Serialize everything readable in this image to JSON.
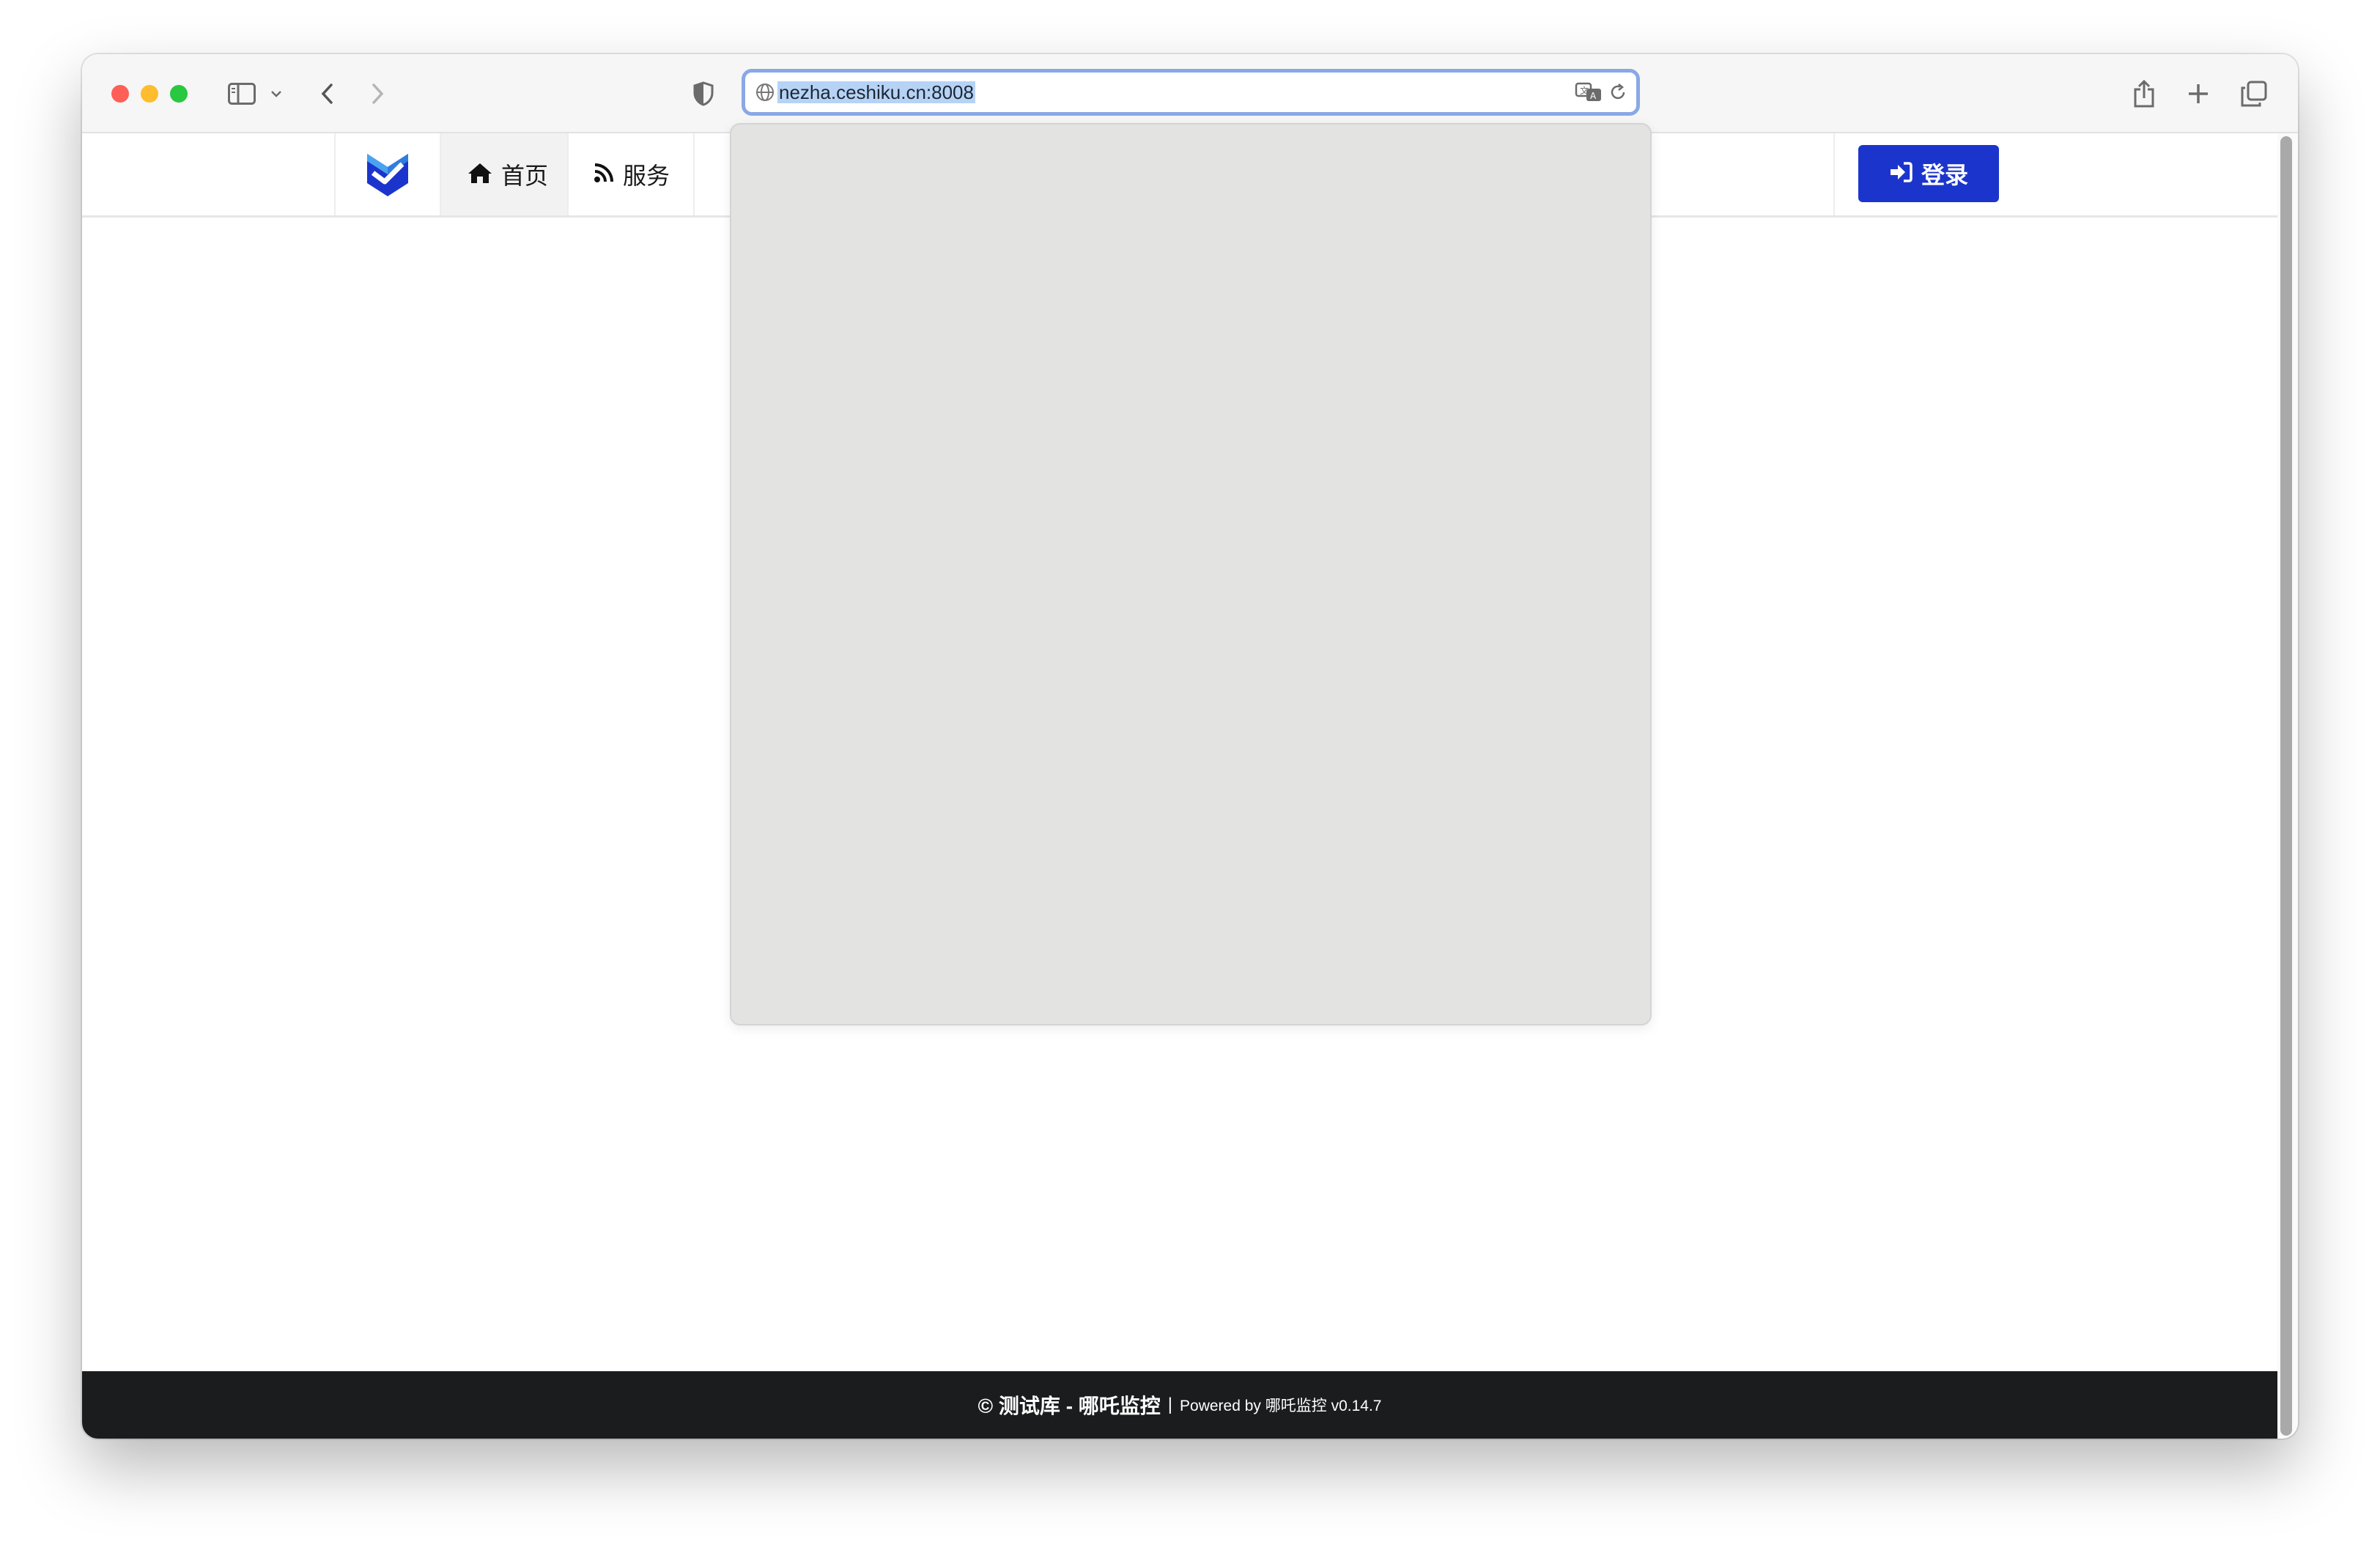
{
  "browser": {
    "url": "nezha.ceshiku.cn:8008",
    "icons": [
      "sidebar-icon",
      "chevron-down-icon",
      "back-icon",
      "forward-icon",
      "shield-icon",
      "globe-icon",
      "translate-icon",
      "reload-icon",
      "share-icon",
      "plus-icon",
      "tabs-icon"
    ]
  },
  "nav": {
    "home_label": "首页",
    "service_label": "服务",
    "login_label": "登录",
    "accent_color": "#1b35cc"
  },
  "footer": {
    "copyright": "© 测试库 - 哪吒监控",
    "separator": "|",
    "powered": "Powered by 哪吒监控 v0.14.7"
  }
}
